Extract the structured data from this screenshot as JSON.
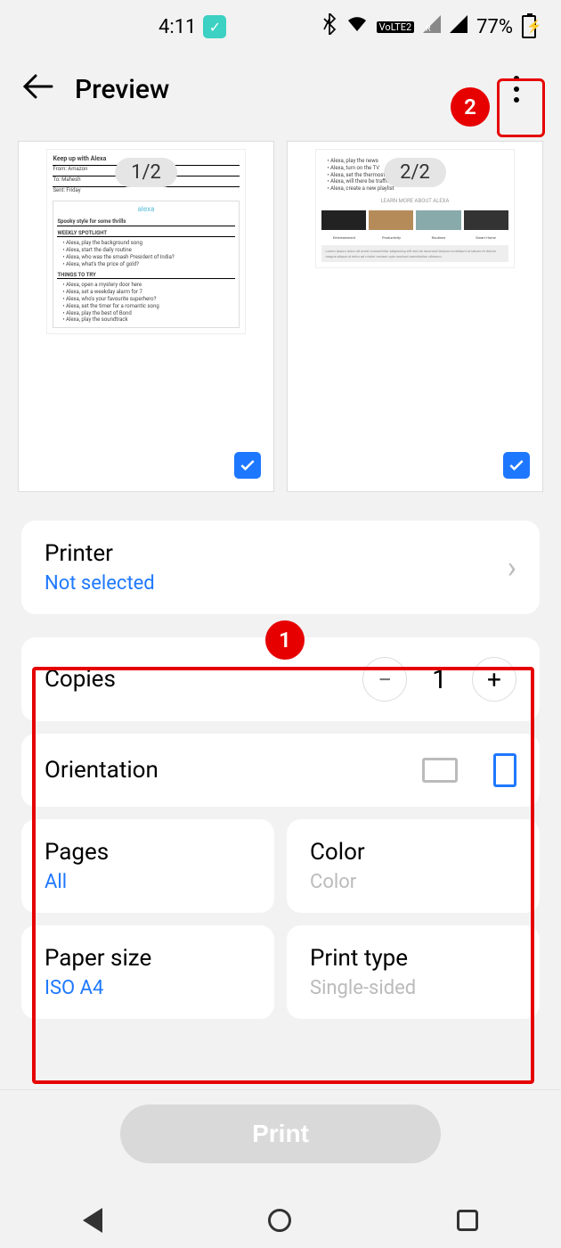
{
  "status": {
    "time": "4:11",
    "battery_pct": "77%",
    "lte_label": "VoLTE2"
  },
  "header": {
    "title": "Preview"
  },
  "annotations": {
    "badge1": "1",
    "badge2": "2"
  },
  "thumbs": {
    "page1_badge": "1/2",
    "page2_badge": "2/2",
    "p1": {
      "title": "Keep up with Alexa",
      "from": "From: Amazon",
      "to": "To: Mahesh",
      "sent": "Sent: Friday",
      "alexa": "alexa",
      "s1": "Spooky style for some thrills",
      "s2": "WEEKLY SPOTLIGHT",
      "s3": "THINGS TO TRY",
      "li1": "Alexa, play the background song",
      "li2": "Alexa, start the daily routine",
      "li3": "Alexa, who was the smash President of India?",
      "li4": "Alexa, what's the price of gold?",
      "li5": "Alexa, open a mystery door here",
      "li6": "Alexa, set a weekday alarm for 7",
      "li7": "Alexa, who's your favourite superhero?",
      "li8": "Alexa, set the timer for a romantic song",
      "li9": "Alexa, play the best of Bond",
      "li10": "Alexa, play the soundtrack"
    },
    "p2": {
      "caption": "LEARN MORE ABOUT ALEXA",
      "c1": "Entertainment",
      "c2": "Productivity",
      "c3": "Routines",
      "c4": "Smart Home",
      "li1": "Alexa, play the news",
      "li2": "Alexa, turn on the TV",
      "li3": "Alexa, set the thermostat to cool",
      "li4": "Alexa, will there be traffic on my road?",
      "li5": "Alexa, create a new playlist"
    }
  },
  "printer": {
    "label": "Printer",
    "value": "Not selected"
  },
  "copies": {
    "label": "Copies",
    "value": "1"
  },
  "orientation": {
    "label": "Orientation"
  },
  "pages": {
    "label": "Pages",
    "value": "All"
  },
  "color": {
    "label": "Color",
    "value": "Color"
  },
  "paper": {
    "label": "Paper size",
    "value": "ISO A4"
  },
  "ptype": {
    "label": "Print type",
    "value": "Single-sided"
  },
  "print_btn": "Print"
}
